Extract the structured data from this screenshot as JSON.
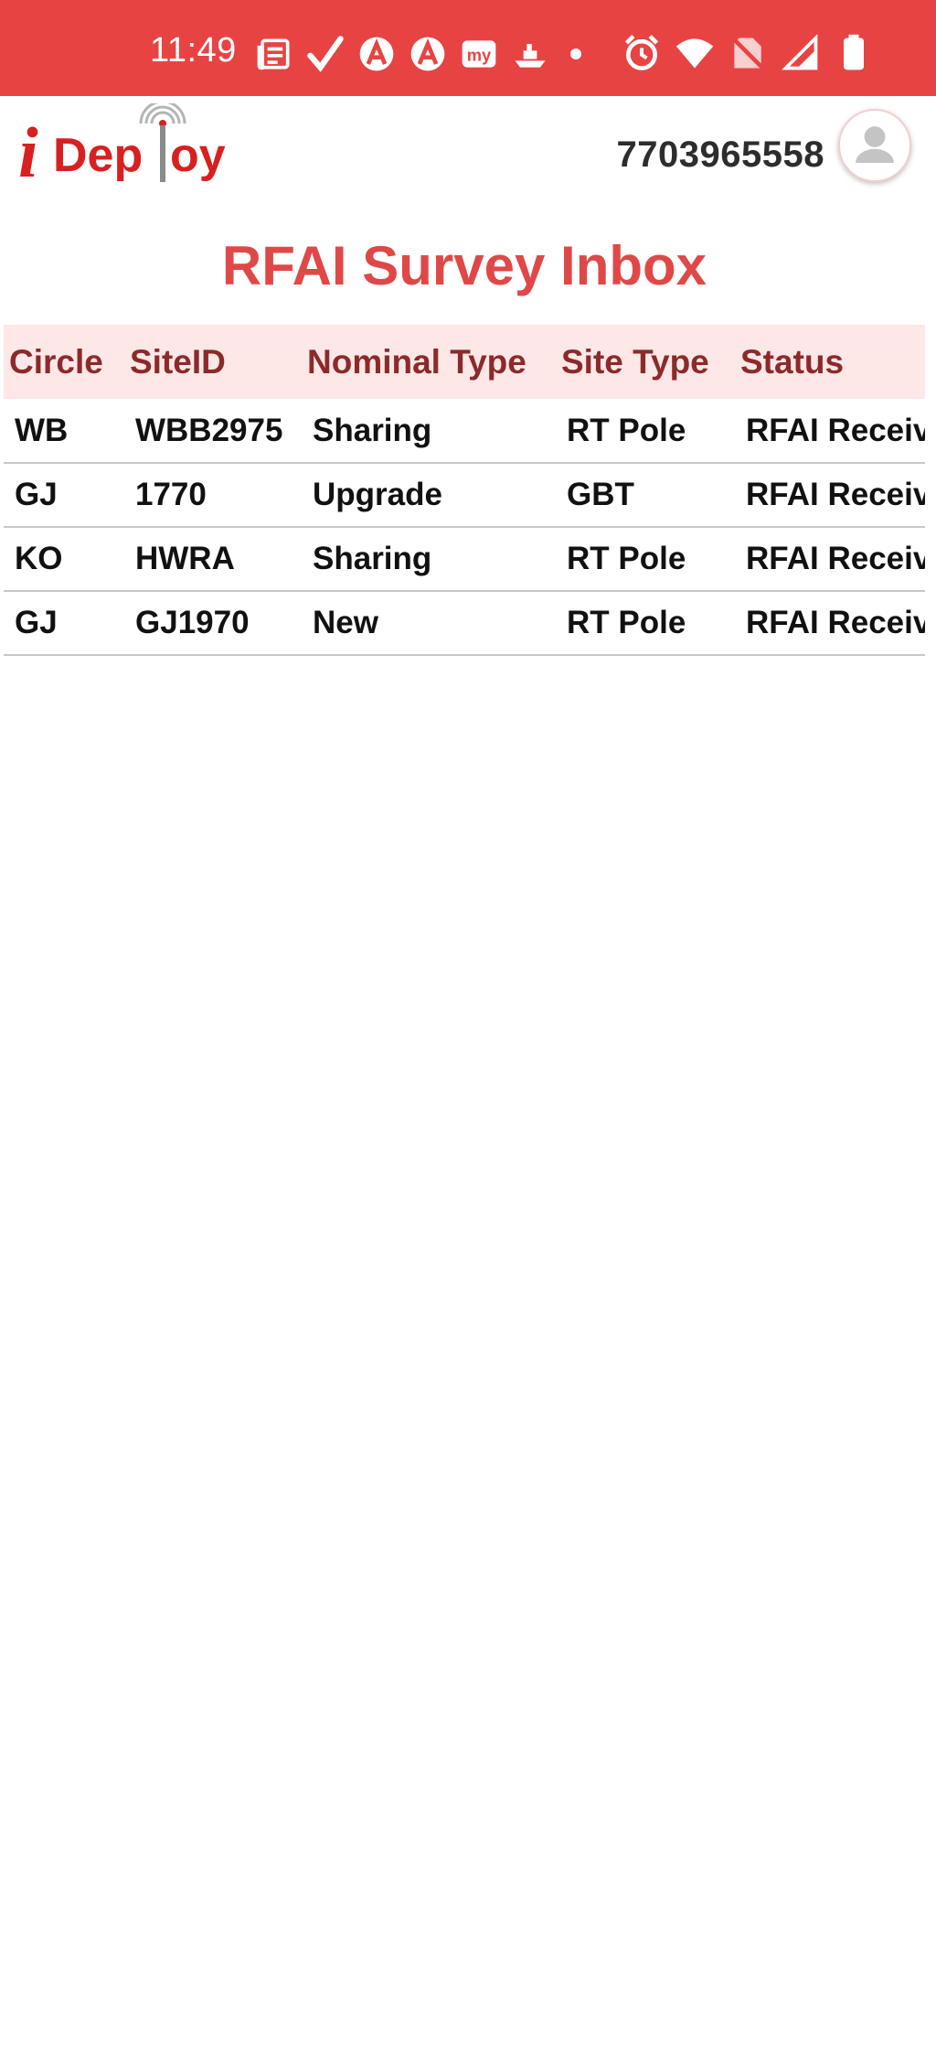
{
  "status_bar": {
    "time": "11:49",
    "left_icons": [
      "news-icon",
      "check-icon",
      "app-a-icon",
      "app-a-icon-2",
      "my-app-icon",
      "boat-icon",
      "notification-dot-icon"
    ],
    "right_icons": [
      "alarm-icon",
      "wifi-icon",
      "no-sim-icon",
      "cell-signal-icon",
      "battery-icon"
    ]
  },
  "app_bar": {
    "logo_text": "iDeploy",
    "phone": "7703965558",
    "avatar_icon": "user-avatar-icon"
  },
  "page": {
    "title": "RFAI Survey Inbox"
  },
  "table": {
    "headers": [
      "Circle",
      "SiteID",
      "Nominal Type",
      "Site Type",
      "Status"
    ],
    "rows": [
      [
        "WB",
        "WBB2975",
        "Sharing",
        "RT Pole",
        "RFAI Received"
      ],
      [
        "GJ",
        "1770",
        "Upgrade",
        "GBT",
        "RFAI Received"
      ],
      [
        "KO",
        "HWRA",
        "Sharing",
        "RT Pole",
        "RFAI Received"
      ],
      [
        "GJ",
        "GJ1970",
        "New",
        "RT Pole",
        "RFAI Received"
      ]
    ]
  },
  "colors": {
    "status_bar_bg": "#e84343",
    "title": "#e04848",
    "header_bg": "#fde7e7",
    "header_text": "#8c2a2a"
  }
}
